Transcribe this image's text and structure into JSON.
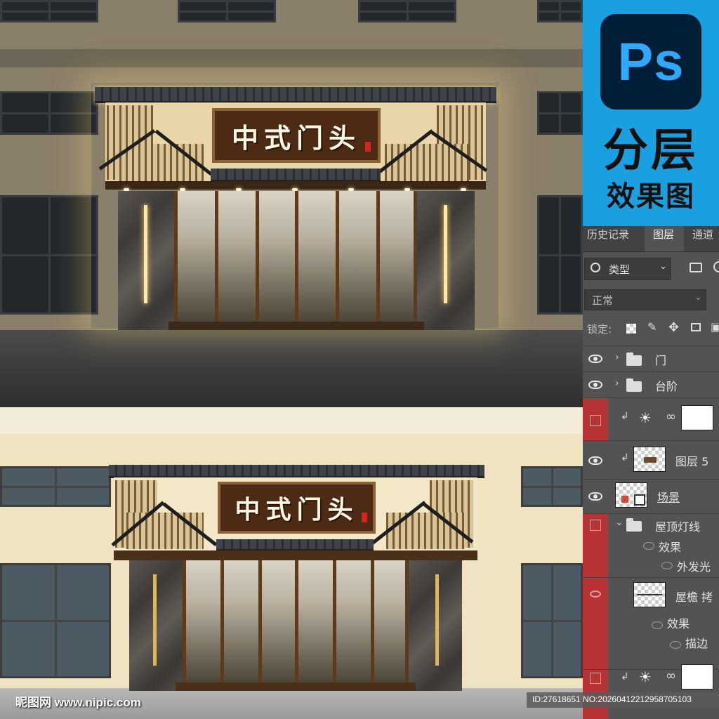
{
  "storefront": {
    "sign_text": "中式门头"
  },
  "ps_panel": {
    "logo_text": "Ps",
    "promo_title": "分层",
    "promo_subtitle": "效果图",
    "tabs": [
      {
        "label": "历史记录",
        "active": false
      },
      {
        "label": "图层",
        "active": true
      },
      {
        "label": "通道",
        "active": false
      }
    ],
    "filter": {
      "label": "类型"
    },
    "blend_mode": "正常",
    "lock_label": "锁定:",
    "layers": [
      {
        "name": "门",
        "type": "group",
        "visible": true
      },
      {
        "name": "台阶",
        "type": "group",
        "visible": true
      },
      {
        "name": "",
        "type": "adjustment",
        "visible": false
      },
      {
        "name": "图层 5",
        "type": "pixel",
        "visible": true
      },
      {
        "name": "场景",
        "type": "smart",
        "visible": true
      },
      {
        "name": "屋顶灯线",
        "type": "group",
        "visible": false,
        "expanded": true
      },
      {
        "name": "效果",
        "type": "effects",
        "visible": false
      },
      {
        "name": "外发光",
        "type": "effect",
        "visible": false
      },
      {
        "name": "屋檐 拷",
        "type": "pixel",
        "visible": false
      },
      {
        "name": "效果",
        "type": "effects",
        "visible": false
      },
      {
        "name": "描边",
        "type": "effect",
        "visible": false
      },
      {
        "name": "",
        "type": "adjustment",
        "visible": false
      }
    ]
  },
  "watermark": {
    "site": "昵图网 www.nipic.com",
    "id_text": "ID:27618651 NO:20260412212958705103"
  },
  "colors": {
    "ps_blue": "#1aa0e0",
    "ps_logo_bg": "#001e36",
    "ps_logo_fg": "#31a8ff",
    "panel_bg": "#535353",
    "hidden_layer_red": "#b83434",
    "sign_wood": "#4d2a14"
  }
}
